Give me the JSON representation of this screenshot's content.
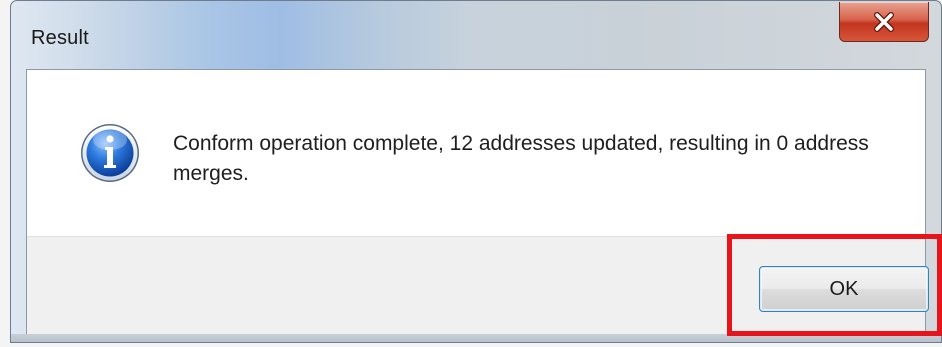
{
  "window": {
    "title": "Result",
    "close_glyph": "x"
  },
  "dialog": {
    "icon": "info-icon",
    "message": "Conform operation complete, 12 addresses updated, resulting in 0 address merges."
  },
  "buttons": {
    "ok_label": "OK"
  },
  "colors": {
    "highlight": "#e8141b",
    "close_button": "#c2341f",
    "info_icon": "#1e62c9"
  }
}
